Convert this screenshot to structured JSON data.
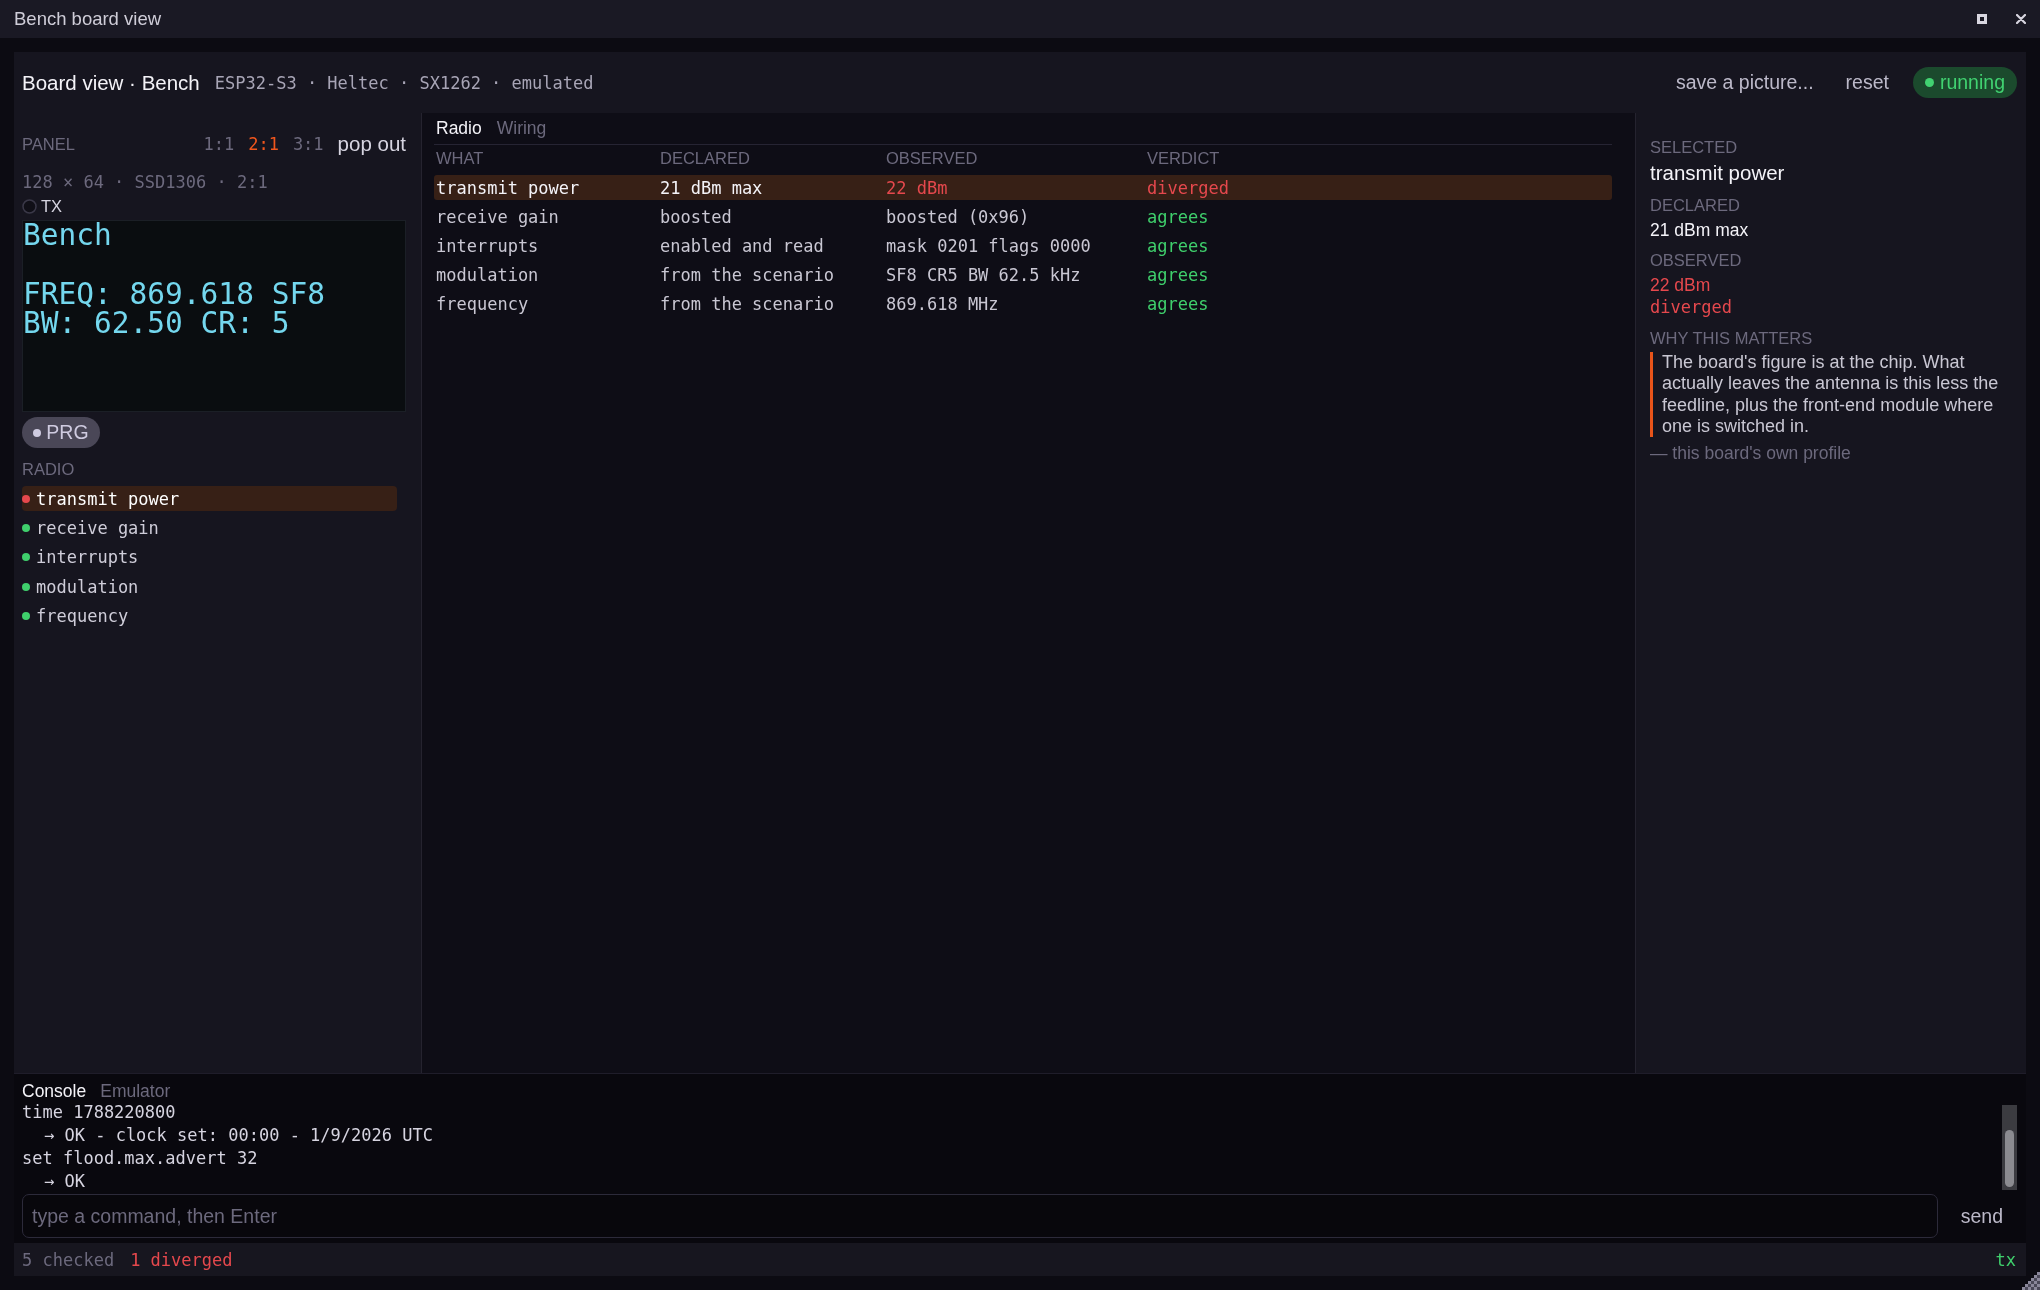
{
  "window": {
    "title": "Bench board view"
  },
  "header": {
    "title": "Board view · Bench",
    "meta": "ESP32-S3 · Heltec · SX1262 · emulated",
    "actions": [
      "save a picture...",
      "reset"
    ],
    "status": {
      "label": "running",
      "kind": "running"
    }
  },
  "panel": {
    "label": "PANEL",
    "scales": [
      {
        "label": "1:1",
        "selected": false
      },
      {
        "label": "2:1",
        "selected": true
      },
      {
        "label": "3:1",
        "selected": false
      }
    ],
    "pop_out": "pop out",
    "spec": "128 × 64 · SSD1306 · 2:1",
    "tx_led": {
      "label": "TX",
      "on": false
    },
    "display": {
      "heading": "Bench",
      "lines": [
        "FREQ: 869.618 SF8",
        "BW: 62.50 CR: 5"
      ]
    },
    "button": {
      "label": "PRG"
    }
  },
  "radio": {
    "label": "RADIO",
    "items": [
      {
        "name": "transmit power",
        "color": "#e5484d",
        "selected": true
      },
      {
        "name": "receive gain",
        "color": "#3fcf6c",
        "selected": false
      },
      {
        "name": "interrupts",
        "color": "#3fcf6c",
        "selected": false
      },
      {
        "name": "modulation",
        "color": "#3fcf6c",
        "selected": false
      },
      {
        "name": "frequency",
        "color": "#3fcf6c",
        "selected": false
      }
    ]
  },
  "checks": {
    "tabs": [
      {
        "label": "Radio",
        "selected": true
      },
      {
        "label": "Wiring",
        "selected": false
      }
    ],
    "columns": [
      "WHAT",
      "DECLARED",
      "OBSERVED",
      "VERDICT"
    ],
    "rows": [
      {
        "what": "transmit power",
        "declared": "21 dBm max",
        "observed": "22 dBm",
        "verdict": "diverged",
        "kind": "diverged",
        "selected": true
      },
      {
        "what": "receive gain",
        "declared": "boosted",
        "observed": "boosted (0x96)",
        "verdict": "agrees",
        "kind": "agrees",
        "selected": false
      },
      {
        "what": "interrupts",
        "declared": "enabled and read",
        "observed": "mask 0201 flags 0000",
        "verdict": "agrees",
        "kind": "agrees",
        "selected": false
      },
      {
        "what": "modulation",
        "declared": "from the scenario",
        "observed": "SF8 CR5 BW 62.5 kHz",
        "verdict": "agrees",
        "kind": "agrees",
        "selected": false
      },
      {
        "what": "frequency",
        "declared": "from the scenario",
        "observed": "869.618 MHz",
        "verdict": "agrees",
        "kind": "agrees",
        "selected": false
      }
    ]
  },
  "detail": {
    "fields": [
      {
        "label": "SELECTED",
        "value": "transmit power",
        "kind": "title"
      },
      {
        "label": "DECLARED",
        "value": "21 dBm max",
        "kind": "plain"
      },
      {
        "label": "OBSERVED",
        "value": "22 dBm",
        "verdict": "diverged",
        "kind": "diverged"
      }
    ],
    "why": {
      "label": "WHY THIS MATTERS",
      "text": "The board's figure is at the chip. What actually leaves the antenna is this less the feedline, plus the front-end module where one is switched in.",
      "source": "— this board's own profile"
    }
  },
  "console": {
    "tabs": [
      {
        "label": "Console",
        "selected": true
      },
      {
        "label": "Emulator",
        "selected": false
      }
    ],
    "log": [
      {
        "text": "time 1788220800",
        "kind": "command"
      },
      {
        "text": "→ OK - clock set: 00:00 - 1/9/2026 UTC",
        "kind": "reply"
      },
      {
        "text": "set flood.max.advert 32",
        "kind": "command"
      },
      {
        "text": "→ OK",
        "kind": "reply"
      }
    ],
    "input": {
      "placeholder": "type a command, then Enter"
    },
    "send": "send"
  },
  "status_bar": {
    "checked": "5 checked",
    "diverged": "1 diverged",
    "activity": "tx"
  }
}
